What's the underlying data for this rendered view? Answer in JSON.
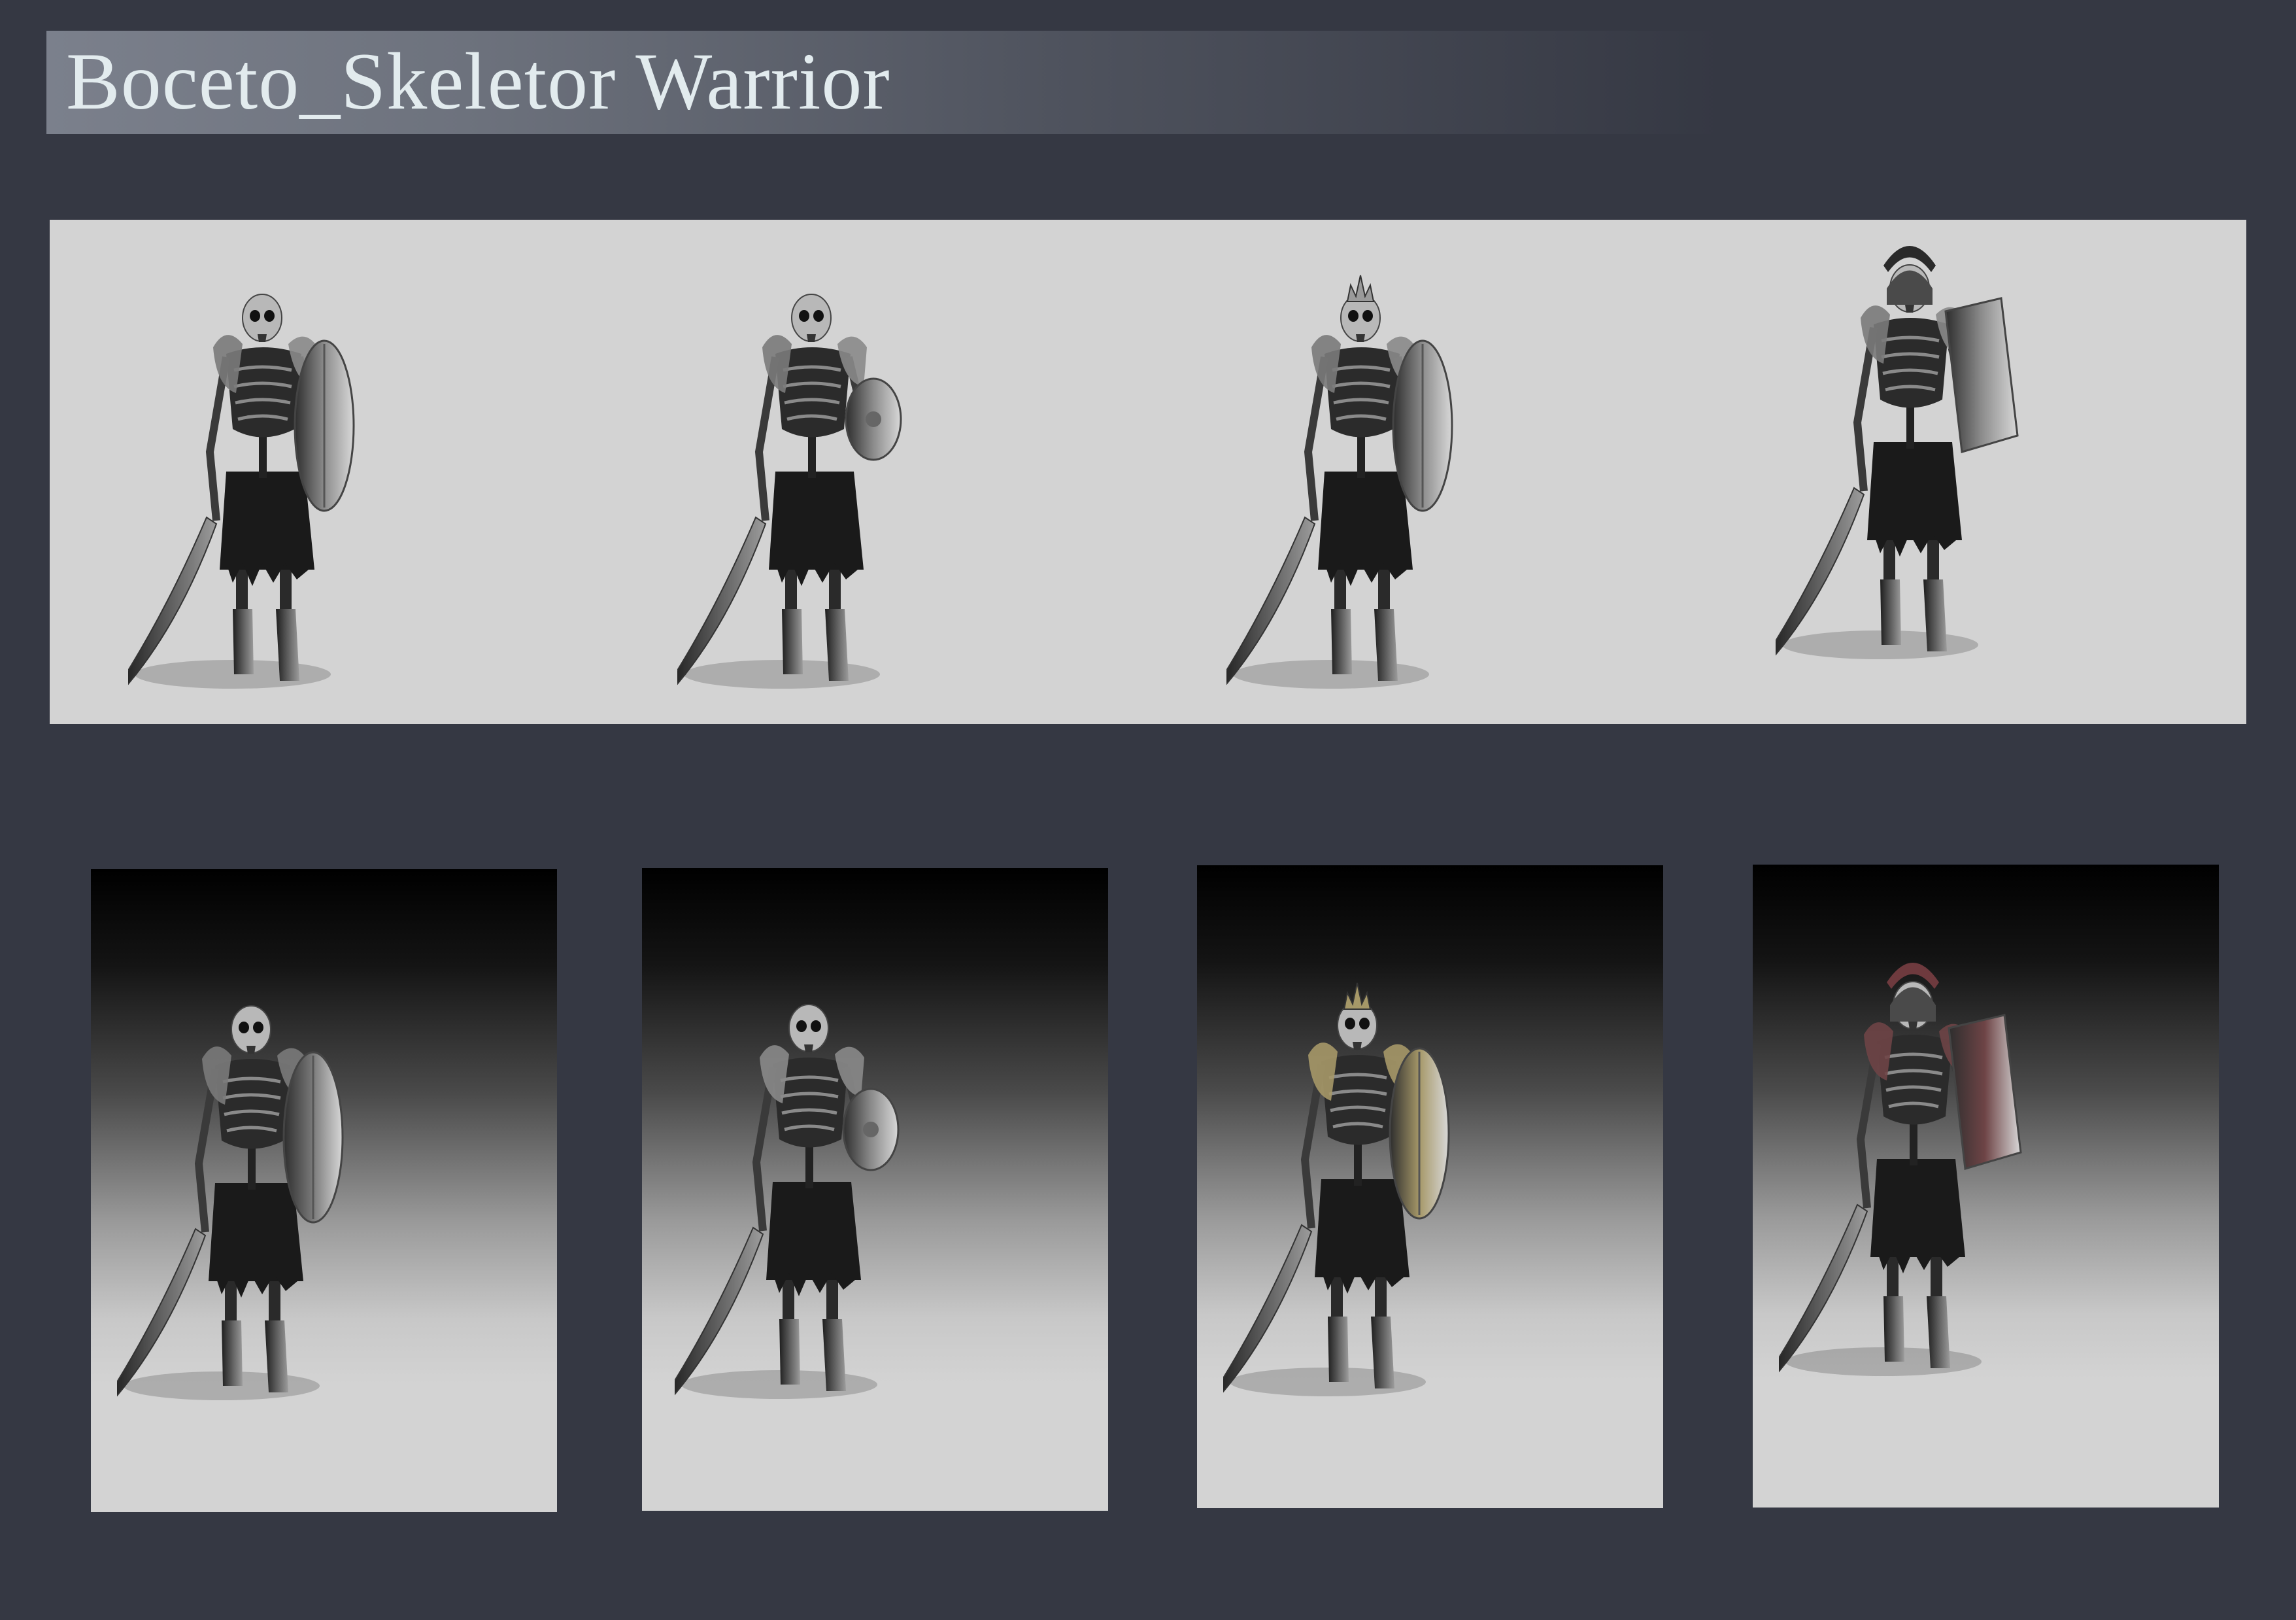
{
  "title": "Boceto_Skeletor Warrior",
  "colors": {
    "background": "#353843",
    "panel_light": "#d3d3d3",
    "title_text": "#e2ebee",
    "bone": "#b8b8b8",
    "gold_armor": "#a69868",
    "red_shield": "#6e4446"
  },
  "sketches_grayscale": [
    {
      "variant": "bare-skull-round-shield",
      "helmet": "none",
      "shield": "oval"
    },
    {
      "variant": "long-hair-small-buckler",
      "helmet": "none",
      "shield": "buckler"
    },
    {
      "variant": "crowned-spiked-shield",
      "helmet": "crown",
      "shield": "oval"
    },
    {
      "variant": "crested-helmet-tower-shield",
      "helmet": "crested",
      "shield": "tower"
    }
  ],
  "sketches_color": [
    {
      "variant": "bare-skull-round-shield",
      "helmet": "none",
      "shield": "oval",
      "accent": "#7a7a7a"
    },
    {
      "variant": "long-hair-small-buckler",
      "helmet": "none",
      "shield": "buckler",
      "accent": "#8a8a8a"
    },
    {
      "variant": "crowned-spiked-shield",
      "helmet": "crown",
      "shield": "oval",
      "accent": "#a69868"
    },
    {
      "variant": "crested-helmet-tower-shield",
      "helmet": "crested",
      "shield": "tower",
      "accent": "#6e4446"
    }
  ]
}
